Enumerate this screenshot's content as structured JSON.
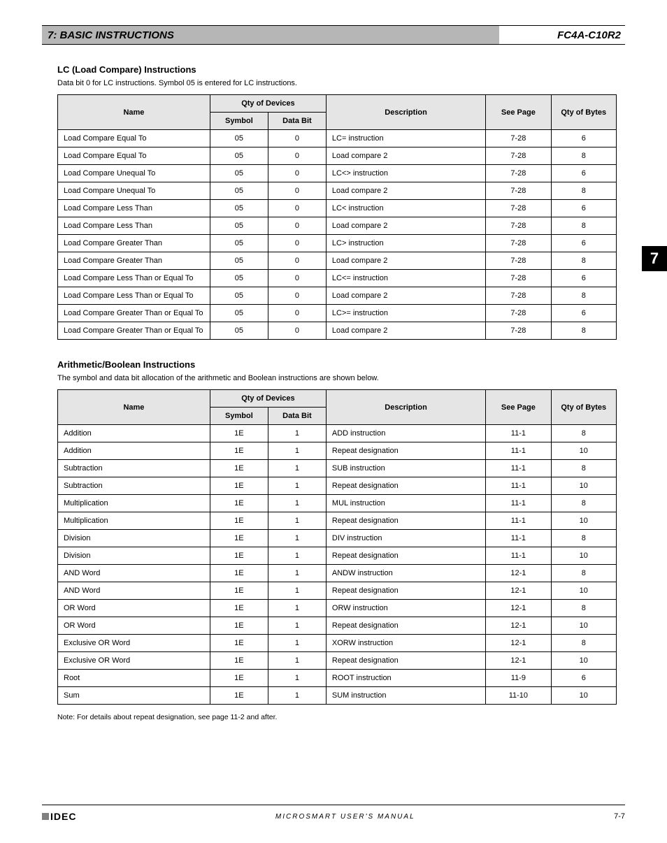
{
  "header": {
    "left": "7: BASIC INSTRUCTIONS",
    "right": "FC4A-C10R2"
  },
  "side_tab": "7",
  "section1": {
    "title": "LC (Load Compare) Instructions",
    "subtitle": "Data bit 0 for LC instructions. Symbol 05 is entered for LC instructions.",
    "columns": {
      "name": "Name",
      "qty_devices": "Qty of Devices",
      "sym": "Symbol",
      "data_bit": "Data Bit",
      "desc": "Description",
      "see": "See Page",
      "qty_bytes": "Qty of Bytes"
    },
    "rows": [
      {
        "name": "Load Compare Equal To",
        "sym": "05",
        "data": "0",
        "desc": "LC= instruction",
        "see": "7-28",
        "qty": "6"
      },
      {
        "name": "Load Compare Equal To",
        "sym": "05",
        "data": "0",
        "desc": "Load compare 2",
        "see": "7-28",
        "qty": "8"
      },
      {
        "name": "Load Compare Unequal To",
        "sym": "05",
        "data": "0",
        "desc": "LC<> instruction",
        "see": "7-28",
        "qty": "6"
      },
      {
        "name": "Load Compare Unequal To",
        "sym": "05",
        "data": "0",
        "desc": "Load compare 2",
        "see": "7-28",
        "qty": "8"
      },
      {
        "name": "Load Compare Less Than",
        "sym": "05",
        "data": "0",
        "desc": "LC< instruction",
        "see": "7-28",
        "qty": "6"
      },
      {
        "name": "Load Compare Less Than",
        "sym": "05",
        "data": "0",
        "desc": "Load compare 2",
        "see": "7-28",
        "qty": "8"
      },
      {
        "name": "Load Compare Greater Than",
        "sym": "05",
        "data": "0",
        "desc": "LC> instruction",
        "see": "7-28",
        "qty": "6"
      },
      {
        "name": "Load Compare Greater Than",
        "sym": "05",
        "data": "0",
        "desc": "Load compare 2",
        "see": "7-28",
        "qty": "8"
      },
      {
        "name": "Load Compare Less Than or Equal To",
        "sym": "05",
        "data": "0",
        "desc": "LC<= instruction",
        "see": "7-28",
        "qty": "6"
      },
      {
        "name": "Load Compare Less Than or Equal To",
        "sym": "05",
        "data": "0",
        "desc": "Load compare 2",
        "see": "7-28",
        "qty": "8"
      },
      {
        "name": "Load Compare Greater Than or Equal To",
        "sym": "05",
        "data": "0",
        "desc": "LC>= instruction",
        "see": "7-28",
        "qty": "6"
      },
      {
        "name": "Load Compare Greater Than or Equal To",
        "sym": "05",
        "data": "0",
        "desc": "Load compare 2",
        "see": "7-28",
        "qty": "8"
      }
    ]
  },
  "section2": {
    "title": "Arithmetic/Boolean Instructions",
    "subtitle": "The symbol and data bit allocation of the arithmetic and Boolean instructions are shown below.",
    "columns": {
      "name": "Name",
      "qty_devices": "Qty of Devices",
      "sym": "Symbol",
      "data_bit": "Data Bit",
      "desc": "Description",
      "see": "See Page",
      "qty_bytes": "Qty of Bytes"
    },
    "rows": [
      {
        "name": "Addition",
        "sym": "1E",
        "data": "1",
        "desc": "ADD instruction",
        "see": "11-1",
        "qty": "8"
      },
      {
        "name": "Addition",
        "sym": "1E",
        "data": "1",
        "desc": "Repeat designation",
        "see": "11-1",
        "qty": "10"
      },
      {
        "name": "Subtraction",
        "sym": "1E",
        "data": "1",
        "desc": "SUB instruction",
        "see": "11-1",
        "qty": "8"
      },
      {
        "name": "Subtraction",
        "sym": "1E",
        "data": "1",
        "desc": "Repeat designation",
        "see": "11-1",
        "qty": "10"
      },
      {
        "name": "Multiplication",
        "sym": "1E",
        "data": "1",
        "desc": "MUL instruction",
        "see": "11-1",
        "qty": "8"
      },
      {
        "name": "Multiplication",
        "sym": "1E",
        "data": "1",
        "desc": "Repeat designation",
        "see": "11-1",
        "qty": "10"
      },
      {
        "name": "Division",
        "sym": "1E",
        "data": "1",
        "desc": "DIV instruction",
        "see": "11-1",
        "qty": "8"
      },
      {
        "name": "Division",
        "sym": "1E",
        "data": "1",
        "desc": "Repeat designation",
        "see": "11-1",
        "qty": "10"
      },
      {
        "name": "AND Word",
        "sym": "1E",
        "data": "1",
        "desc": "ANDW instruction",
        "see": "12-1",
        "qty": "8"
      },
      {
        "name": "AND Word",
        "sym": "1E",
        "data": "1",
        "desc": "Repeat designation",
        "see": "12-1",
        "qty": "10"
      },
      {
        "name": "OR Word",
        "sym": "1E",
        "data": "1",
        "desc": "ORW instruction",
        "see": "12-1",
        "qty": "8"
      },
      {
        "name": "OR Word",
        "sym": "1E",
        "data": "1",
        "desc": "Repeat designation",
        "see": "12-1",
        "qty": "10"
      },
      {
        "name": "Exclusive OR Word",
        "sym": "1E",
        "data": "1",
        "desc": "XORW instruction",
        "see": "12-1",
        "qty": "8"
      },
      {
        "name": "Exclusive OR Word",
        "sym": "1E",
        "data": "1",
        "desc": "Repeat designation",
        "see": "12-1",
        "qty": "10"
      },
      {
        "name": "Root",
        "sym": "1E",
        "data": "1",
        "desc": "ROOT instruction",
        "see": "11-9",
        "qty": "6"
      },
      {
        "name": "Sum",
        "sym": "1E",
        "data": "1",
        "desc": "SUM instruction",
        "see": "11-10",
        "qty": "10"
      }
    ],
    "note": "Note: For details about repeat designation, see page 11-2 and after."
  },
  "footer": {
    "mid": "MICROSMART  USER'S  MANUAL",
    "page": "7-7"
  }
}
